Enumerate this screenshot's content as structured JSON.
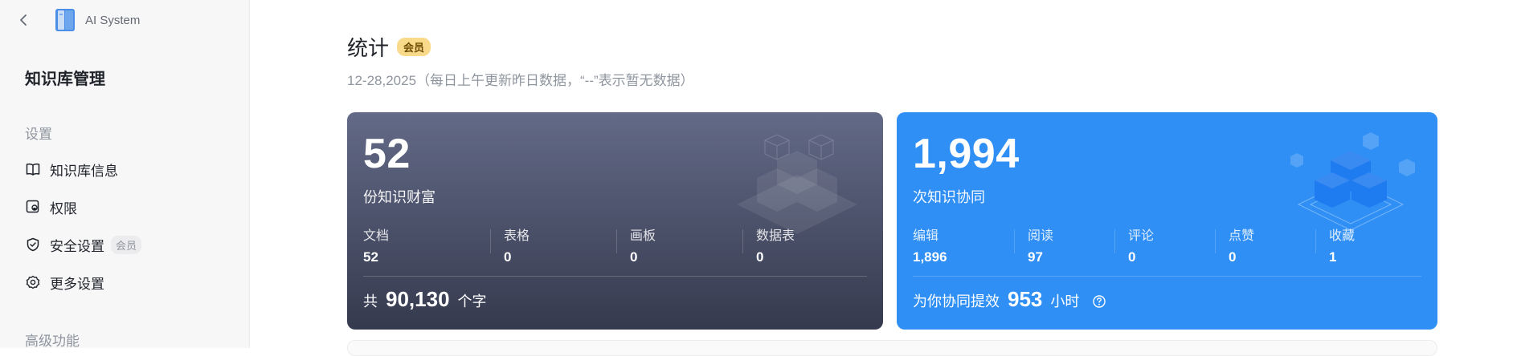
{
  "topbar": {
    "app_name": "AI System"
  },
  "sidebar": {
    "title": "知识库管理",
    "section_settings": "设置",
    "items": [
      {
        "label": "知识库信息",
        "icon": "book-icon"
      },
      {
        "label": "权限",
        "icon": "permission-icon"
      },
      {
        "label": "安全设置",
        "icon": "shield-icon",
        "badge": "会员"
      },
      {
        "label": "更多设置",
        "icon": "gear-icon"
      }
    ],
    "section_advanced": "高级功能"
  },
  "main": {
    "title": "统计",
    "member_badge": "会员",
    "subtitle": "12-28,2025（每日上午更新昨日数据，“--”表示暂无数据）"
  },
  "card_knowledge": {
    "number": "52",
    "label": "份知识财富",
    "metrics": [
      {
        "label": "文档",
        "value": "52"
      },
      {
        "label": "表格",
        "value": "0"
      },
      {
        "label": "画板",
        "value": "0"
      },
      {
        "label": "数据表",
        "value": "0"
      }
    ],
    "footer_prefix": "共",
    "footer_value": "90,130",
    "footer_suffix": "个字"
  },
  "card_collab": {
    "number": "1,994",
    "label": "次知识协同",
    "metrics": [
      {
        "label": "编辑",
        "value": "1,896"
      },
      {
        "label": "阅读",
        "value": "97"
      },
      {
        "label": "评论",
        "value": "0"
      },
      {
        "label": "点赞",
        "value": "0"
      },
      {
        "label": "收藏",
        "value": "1"
      }
    ],
    "footer_prefix": "为你协同提效",
    "footer_value": "953",
    "footer_suffix": "小时"
  },
  "colors": {
    "dark_card_top": "#636a87",
    "dark_card_bottom": "#353a4e",
    "blue_card": "#2f8ff5",
    "member_badge": "#f9d98a"
  }
}
